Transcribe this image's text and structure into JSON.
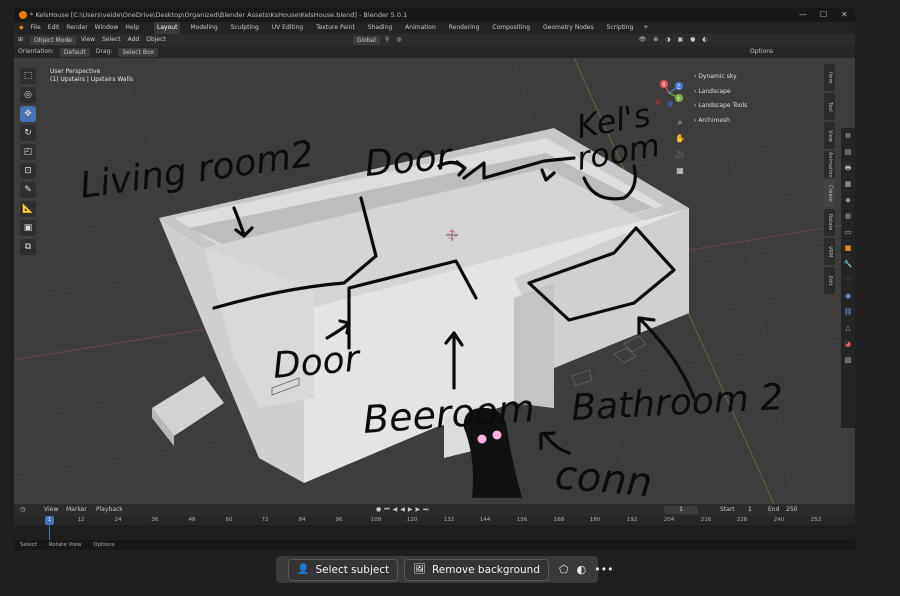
{
  "window": {
    "title": "* KelsHouse [C:\\Users\\veide\\OneDrive\\Desktop\\Organized\\Blender Assets\\KsHouse\\KelsHouse.blend] - Blender 5.0.1",
    "minimize": "—",
    "maximize": "☐",
    "close": "✕"
  },
  "menu": {
    "items": [
      "File",
      "Edit",
      "Render",
      "Window",
      "Help"
    ],
    "workspaces": [
      "Layout",
      "Modeling",
      "Sculpting",
      "UV Editing",
      "Texture Paint",
      "Shading",
      "Animation",
      "Rendering",
      "Compositing",
      "Geometry Nodes",
      "Scripting"
    ],
    "active_workspace": "Layout",
    "add_tab": "+"
  },
  "viewport_header": {
    "mode": "Object Mode",
    "items": [
      "View",
      "Select",
      "Add",
      "Object"
    ],
    "transform": "Global"
  },
  "tool_settings": {
    "orientation_label": "Orientation:",
    "orientation_value": "Default",
    "drag_label": "Drag:",
    "drag_value": "Select Box",
    "options": "Options"
  },
  "viewport": {
    "perspective": "User Perspective",
    "collection": "(1) Upstairs | Upstairs Walls",
    "gizmo_axes": [
      "X",
      "Y",
      "Z"
    ]
  },
  "outliner_panel": {
    "items": [
      "Dynamic sky",
      "Landscape",
      "Landscape Tools",
      "Archimesh"
    ]
  },
  "side_tabs": [
    "Item",
    "Tool",
    "View",
    "Animation",
    "Create",
    "Rotate",
    "VRM",
    "Edit"
  ],
  "annotations": {
    "living_room": "Living room2",
    "door_top": "Door",
    "kels_room_1": "Kel's",
    "kels_room_2": "room",
    "door_bottom": "Door",
    "bedroom": "Beeroom",
    "bathroom": "Bathroom 2",
    "conn": "conn"
  },
  "timeline": {
    "items": [
      "View",
      "Marker",
      "Playback"
    ],
    "current_frame": "1",
    "start_label": "Start",
    "start_value": "1",
    "end_label": "End",
    "end_value": "250",
    "ruler": [
      "1",
      "12",
      "24",
      "36",
      "48",
      "60",
      "72",
      "84",
      "96",
      "108",
      "120",
      "132",
      "144",
      "156",
      "168",
      "180",
      "192",
      "204",
      "216",
      "228",
      "240",
      "252"
    ]
  },
  "statusbar": {
    "items": [
      "Select",
      "Rotate View",
      "Options"
    ]
  },
  "bottom_toolbar": {
    "select_subject": "Select subject",
    "remove_background": "Remove background",
    "more": "•••"
  },
  "colors": {
    "accent": "#4772b3",
    "ink": "#111111",
    "walls": "#d9d9d9"
  }
}
